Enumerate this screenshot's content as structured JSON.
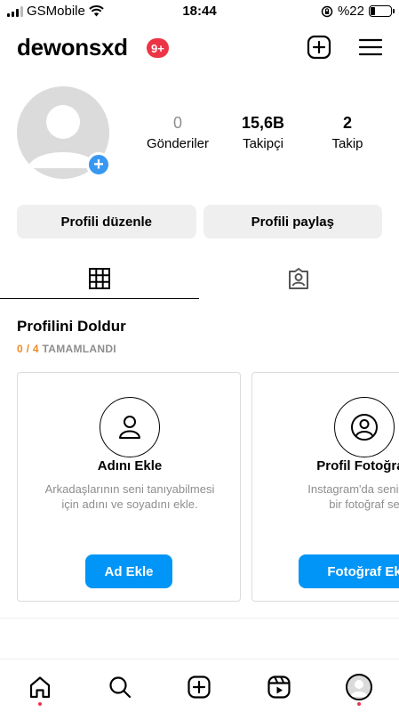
{
  "status_bar": {
    "carrier": "GSMobile",
    "time": "18:44",
    "battery": "%22",
    "icons": [
      "signal-icon",
      "wifi-icon",
      "screen-lock-icon",
      "battery-icon"
    ]
  },
  "header": {
    "username": "dewonsxd",
    "notification_badge": "9+",
    "icons": [
      "new-post-icon",
      "menu-icon"
    ],
    "badge_color": "#ed3446"
  },
  "profile": {
    "avatar_icon": "default-avatar-icon",
    "add_icon": "plus-icon",
    "stats": [
      {
        "value": "0",
        "label": "Gönderiler"
      },
      {
        "value": "15,6B",
        "label": "Takipçi"
      },
      {
        "value": "2",
        "label": "Takip"
      }
    ]
  },
  "buttons": {
    "edit_profile": "Profili düzenle",
    "share_profile": "Profili paylaş"
  },
  "tabs": [
    {
      "icon": "grid-icon",
      "active": true
    },
    {
      "icon": "tagged-icon",
      "active": false
    }
  ],
  "complete_profile": {
    "title": "Profilini Doldur",
    "progress_count": "0 / 4",
    "progress_label": "TAMAMLANDI",
    "progress_color": "#f08a24",
    "cards": [
      {
        "icon": "person-icon",
        "title": "Adını Ekle",
        "desc_line1": "Arkadaşlarının seni tanıyabilmesi",
        "desc_line2": "için adını ve soyadını ekle.",
        "button": "Ad Ekle"
      },
      {
        "icon": "profile-photo-icon",
        "title": "Profil Fotoğrafı",
        "desc_line1": "Instagram'da seni tem",
        "desc_line2": "bir fotoğraf se",
        "button": "Fotoğraf Ek"
      }
    ],
    "button_color": "#0095f6"
  },
  "bottom_nav": {
    "items": [
      "home-icon",
      "search-icon",
      "create-icon",
      "reels-icon",
      "profile-icon"
    ],
    "dot_color": "#ed3446"
  }
}
